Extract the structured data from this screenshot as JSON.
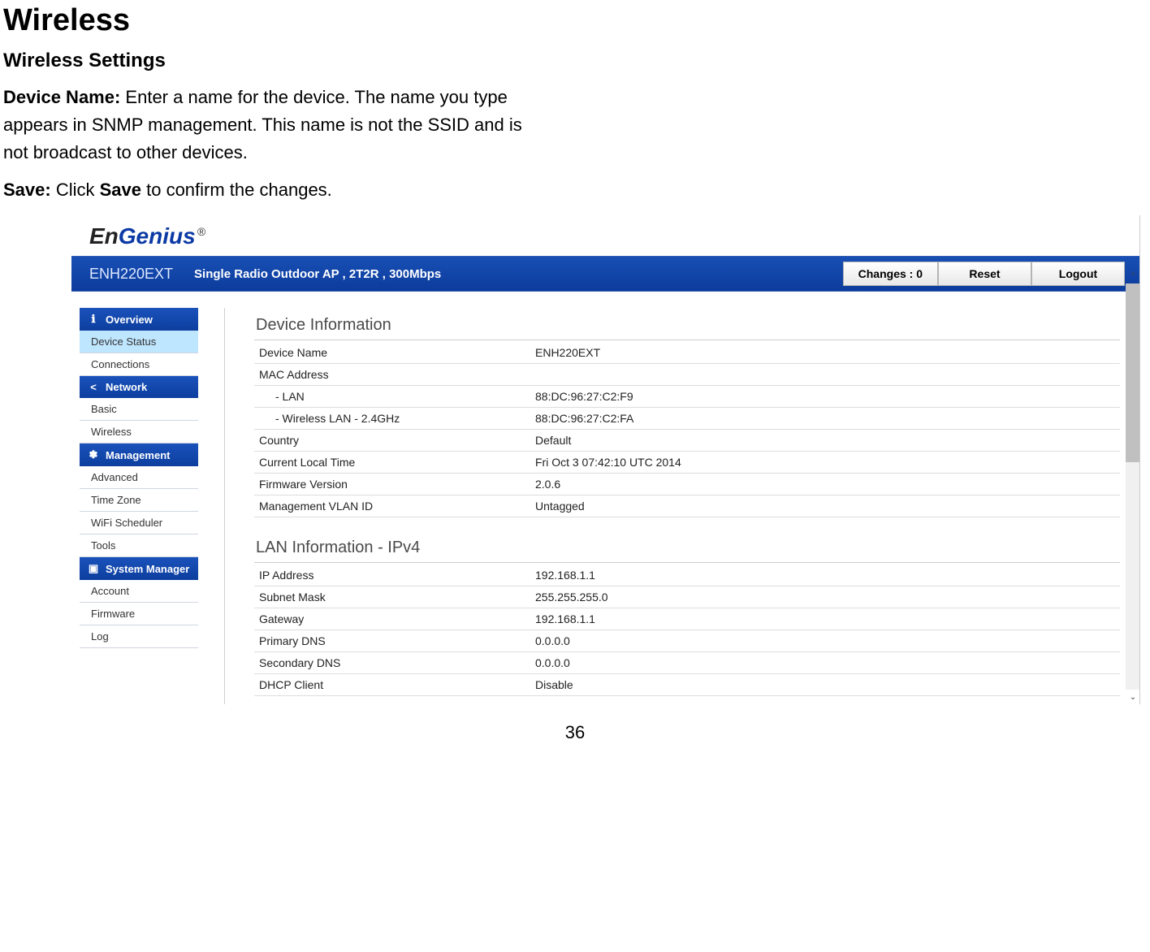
{
  "doc": {
    "heading": "Wireless",
    "subheading": "Wireless Settings",
    "paras": [
      {
        "label": "Device Name:",
        "text": " Enter a name for the device. The name you type appears in SNMP management. This name is not the SSID and is not broadcast to other devices."
      },
      {
        "label": "Save:",
        "lead": " Click ",
        "strong": "Save",
        "tail": " to confirm the changes."
      }
    ],
    "page_number": "36"
  },
  "brand": {
    "part1": "En",
    "part2": "Genius",
    "reg": "®"
  },
  "product_bar": {
    "name": "ENH220EXT",
    "desc": "Single Radio Outdoor AP , 2T2R , 300Mbps",
    "changes_label": "Changes : 0",
    "reset_label": "Reset",
    "logout_label": "Logout"
  },
  "sidebar": {
    "sections": [
      {
        "icon": "info-icon",
        "label": "Overview",
        "items": [
          {
            "label": "Device Status",
            "active": true
          },
          {
            "label": "Connections"
          }
        ]
      },
      {
        "icon": "network-icon",
        "label": "Network",
        "items": [
          {
            "label": "Basic"
          },
          {
            "label": "Wireless"
          }
        ]
      },
      {
        "icon": "gear-icon",
        "label": "Management",
        "items": [
          {
            "label": "Advanced"
          },
          {
            "label": "Time Zone"
          },
          {
            "label": "WiFi Scheduler"
          },
          {
            "label": "Tools"
          }
        ]
      },
      {
        "icon": "monitor-icon",
        "label": "System Manager",
        "items": [
          {
            "label": "Account"
          },
          {
            "label": "Firmware"
          },
          {
            "label": "Log"
          }
        ]
      }
    ]
  },
  "main": {
    "device_info": {
      "title": "Device Information",
      "rows": [
        {
          "k": "Device Name",
          "v": "ENH220EXT"
        },
        {
          "k": "MAC Address",
          "v": ""
        },
        {
          "k": "- LAN",
          "v": "88:DC:96:27:C2:F9",
          "indent": true
        },
        {
          "k": "- Wireless LAN - 2.4GHz",
          "v": "88:DC:96:27:C2:FA",
          "indent": true
        },
        {
          "k": "Country",
          "v": "Default"
        },
        {
          "k": "Current Local Time",
          "v": "Fri Oct 3 07:42:10 UTC 2014"
        },
        {
          "k": "Firmware Version",
          "v": "2.0.6"
        },
        {
          "k": "Management VLAN ID",
          "v": "Untagged"
        }
      ]
    },
    "lan_info": {
      "title": "LAN Information - IPv4",
      "rows": [
        {
          "k": "IP Address",
          "v": "192.168.1.1"
        },
        {
          "k": "Subnet Mask",
          "v": "255.255.255.0"
        },
        {
          "k": "Gateway",
          "v": "192.168.1.1"
        },
        {
          "k": "Primary DNS",
          "v": "0.0.0.0"
        },
        {
          "k": "Secondary DNS",
          "v": "0.0.0.0"
        },
        {
          "k": "DHCP Client",
          "v": "Disable"
        }
      ]
    }
  },
  "icons": {
    "info-icon": "ℹ",
    "network-icon": "<",
    "gear-icon": "✽",
    "monitor-icon": "▣"
  }
}
